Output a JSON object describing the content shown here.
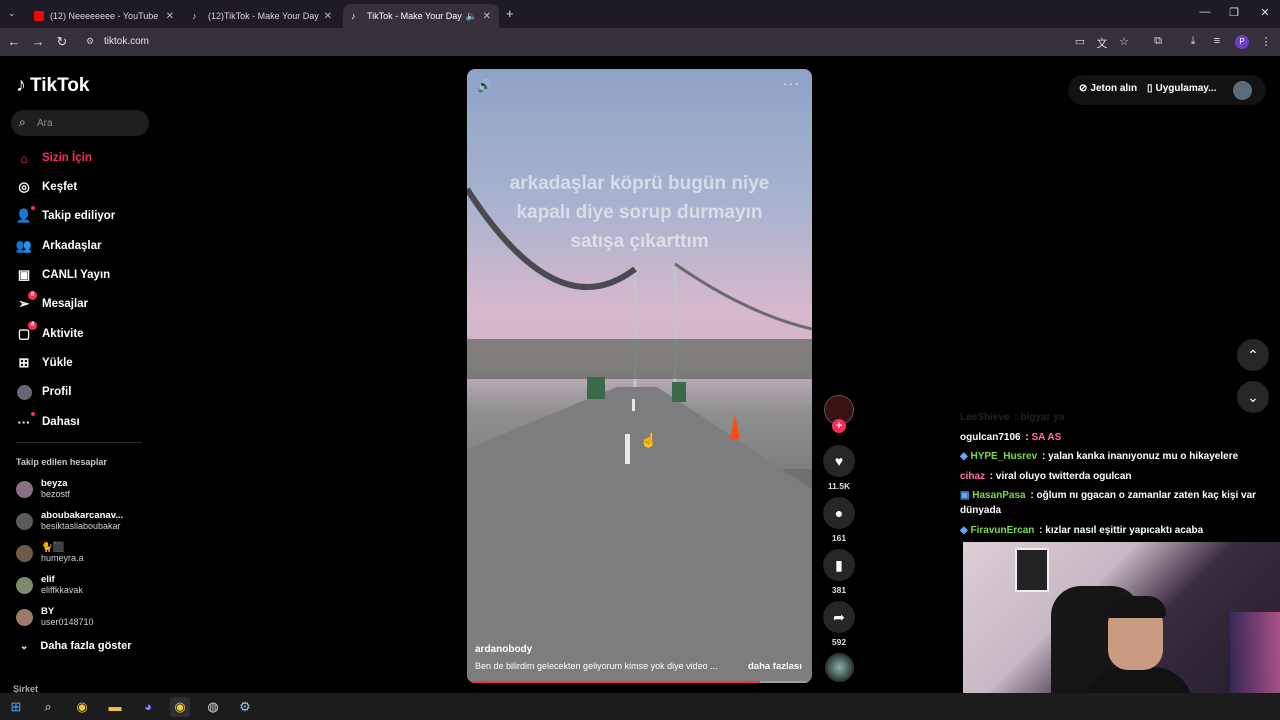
{
  "browser": {
    "tabs": [
      {
        "title": "(12) Neeeeeeee - YouTube",
        "icon": "youtube-icon"
      },
      {
        "title": "(12)TikTok - Make Your Day",
        "icon": "tiktok-icon"
      },
      {
        "title": "TikTok - Make Your Day",
        "icon": "tiktok-icon",
        "active": true
      }
    ],
    "url": "tiktok.com",
    "profile_initial": "P"
  },
  "app": {
    "name": "TikTok",
    "search_placeholder": "Ara"
  },
  "sidebar": {
    "items": [
      {
        "label": "Sizin İçin",
        "icon": "home-icon",
        "active": true
      },
      {
        "label": "Keşfet",
        "icon": "compass-icon"
      },
      {
        "label": "Takip ediliyor",
        "icon": "following-icon"
      },
      {
        "label": "Arkadaşlar",
        "icon": "friends-icon"
      },
      {
        "label": "CANLI Yayın",
        "icon": "live-icon"
      },
      {
        "label": "Mesajlar",
        "icon": "messages-icon",
        "badge": "8"
      },
      {
        "label": "Aktivite",
        "icon": "activity-icon",
        "badge": "4"
      },
      {
        "label": "Yükle",
        "icon": "upload-icon"
      },
      {
        "label": "Profil",
        "icon": "profile-icon"
      },
      {
        "label": "Dahası",
        "icon": "more-icon"
      }
    ],
    "following_heading": "Takip edilen hesaplar",
    "following": [
      {
        "name": "beyza",
        "handle": "bezostf"
      },
      {
        "name": "aboubakarcanav...",
        "handle": "besiktasliaboubakar"
      },
      {
        "name": "🐈⬛",
        "handle": "humeyra.a"
      },
      {
        "name": "elif",
        "handle": "eliffkkavak"
      },
      {
        "name": "BY",
        "handle": "user0148710"
      }
    ],
    "show_more": "Daha fazla göster",
    "company": "Şirket"
  },
  "video": {
    "overlay_text": "arkadaşlar köprü bugün niye kapalı diye sorup durmayın satışa çıkarttım",
    "author": "ardanobody",
    "caption": "Ben de bilirdim gelecekten geliyorum kimse yok diye video ...",
    "more_label": "daha fazlası",
    "progress": 0.85
  },
  "actions": {
    "likes": "11.5K",
    "comments": "161",
    "saves": "381",
    "shares": "592"
  },
  "topbar": {
    "coins_label": "Jeton alın",
    "app_label": "Uygulamay..."
  },
  "chat": [
    {
      "user": "LeeShieve",
      "message": "bigyar ya"
    },
    {
      "user": "ogulcan7106",
      "message": "SA AS"
    },
    {
      "user": "HYPE_Husrev",
      "message": "yalan kanka inanıyonuz mu o hikayelere"
    },
    {
      "user": "cihaz",
      "message": "viral oluyo twitterda ogulcan"
    },
    {
      "user": "HasanPasa",
      "message": "oğlum nı ggacan o zamanlar zaten kaç kişi var dünyada"
    },
    {
      "user": "FiravunErcan",
      "message": "kızlar nasıl eşittir yapıcaktı acaba"
    }
  ],
  "colors": {
    "accent": "#fe2c55",
    "chat_user_green": "#7bd94a",
    "chat_user_pink": "#ff6fa8",
    "chat_user_blue": "#5fa8ff"
  }
}
